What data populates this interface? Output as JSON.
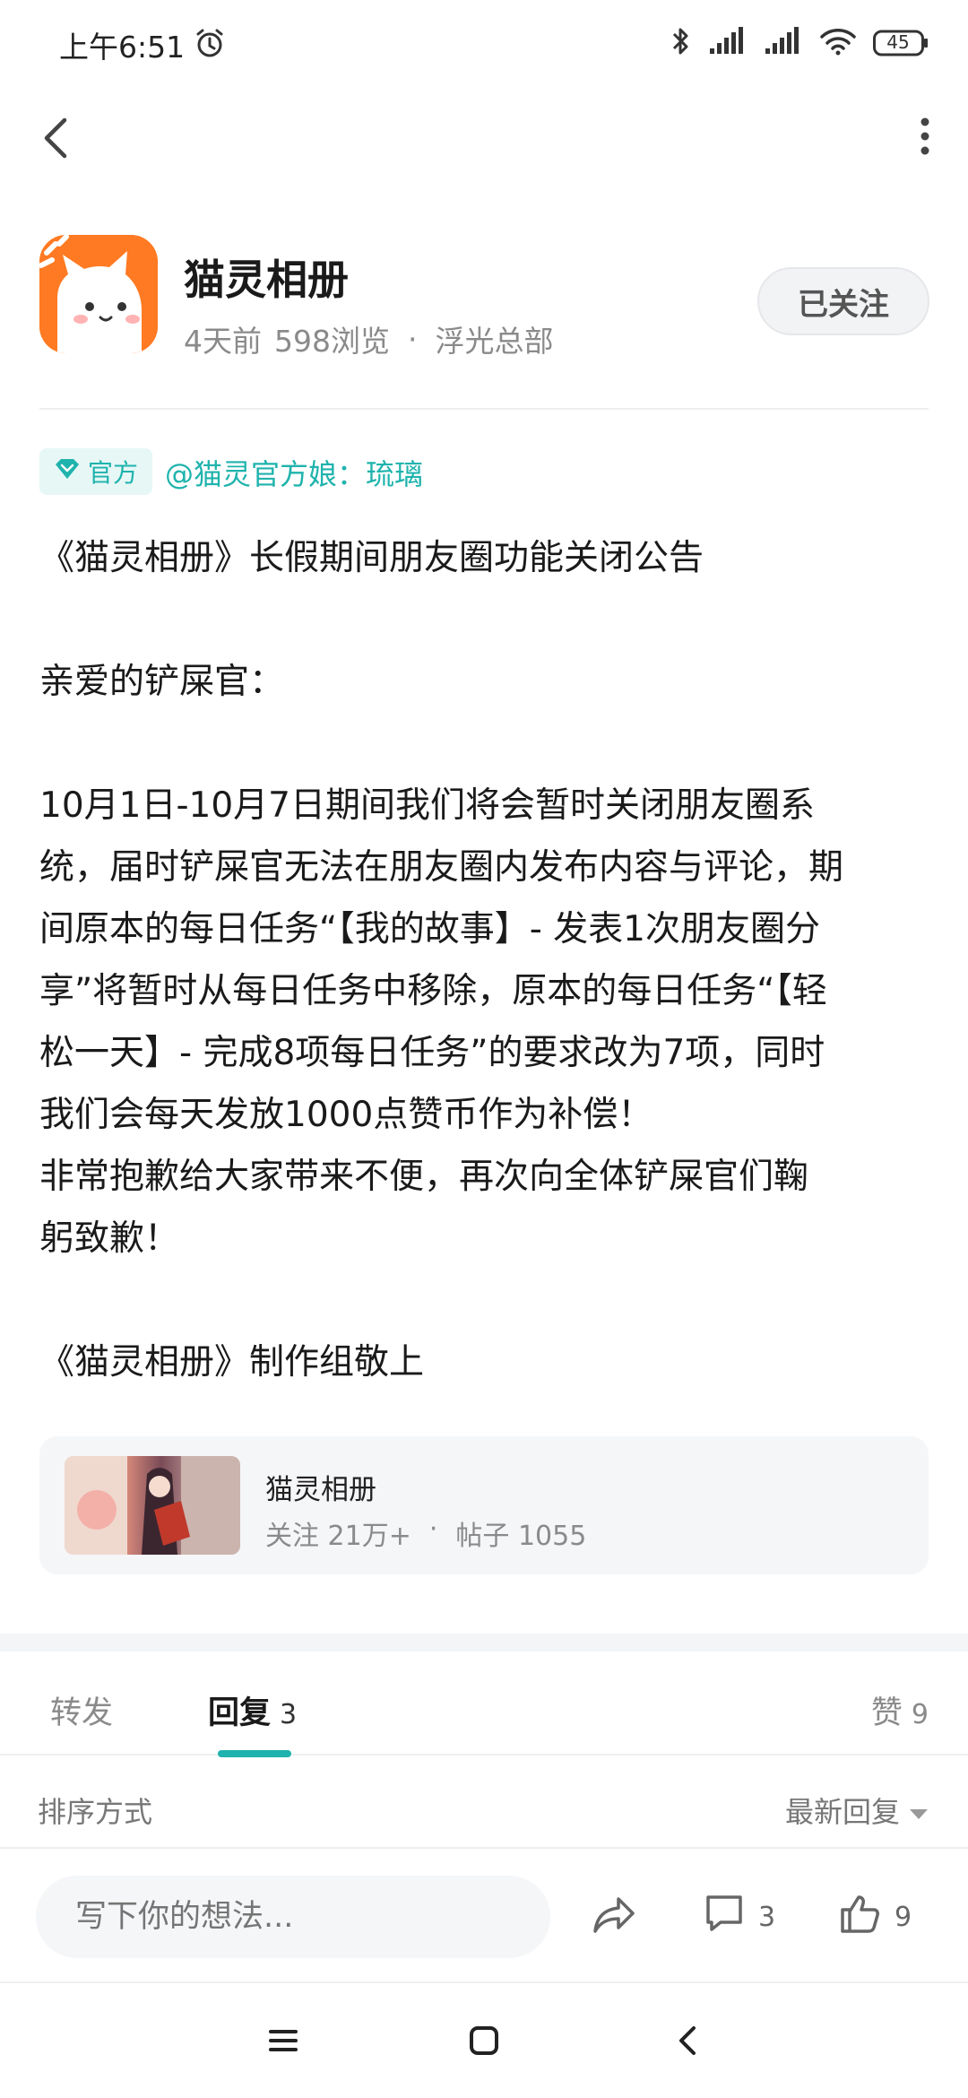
{
  "status_bar": {
    "time": "上午6:51",
    "battery": "45"
  },
  "author": {
    "name": "猫灵相册",
    "time_ago": "4天前",
    "views": "598浏览",
    "dot": "·",
    "section": "浮光总部",
    "follow_label": "已关注"
  },
  "official": {
    "tag_label": "官方",
    "handle": "@猫灵官方娘：琉璃"
  },
  "post": {
    "lines": [
      "《猫灵相册》长假期间朋友圈功能关闭公告",
      "",
      "亲爱的铲屎官：",
      "",
      "10月1日-10月7日期间我们将会暂时关闭朋友圈系",
      "统，届时铲屎官无法在朋友圈内发布内容与评论，期",
      "间原本的每日任务“【我的故事】- 发表1次朋友圈分",
      "享”将暂时从每日任务中移除，原本的每日任务“【轻",
      "松一天】- 完成8项每日任务”的要求改为7项，同时",
      "我们会每天发放1000点赞币作为补偿！",
      "非常抱歉给大家带来不便，再次向全体铲屎官们鞠",
      "躬致歉！",
      "",
      "《猫灵相册》制作组敬上"
    ]
  },
  "circle": {
    "name": "猫灵相册",
    "followers": "关注 21万+",
    "dot": "·",
    "posts": "帖子 1055"
  },
  "tabs": {
    "repost": "转发",
    "reply": "回复",
    "reply_count": "3",
    "like": "赞",
    "like_count": "9"
  },
  "sort": {
    "label": "排序方式",
    "value": "最新回复"
  },
  "action_bar": {
    "placeholder": "写下你的想法...",
    "comment_count": "3",
    "like_count": "9"
  },
  "colors": {
    "accent": "#1fb3ad",
    "brand_orange": "#ff7a22"
  },
  "icons": [
    "back-arrow-icon",
    "more-vertical-icon",
    "alarm-icon",
    "bluetooth-icon",
    "signal-icon",
    "wifi-icon",
    "battery-icon",
    "diamond-icon",
    "share-icon",
    "comment-icon",
    "thumbs-up-icon",
    "dropdown-triangle-icon",
    "menu-icon",
    "home-square-icon",
    "system-back-icon"
  ]
}
